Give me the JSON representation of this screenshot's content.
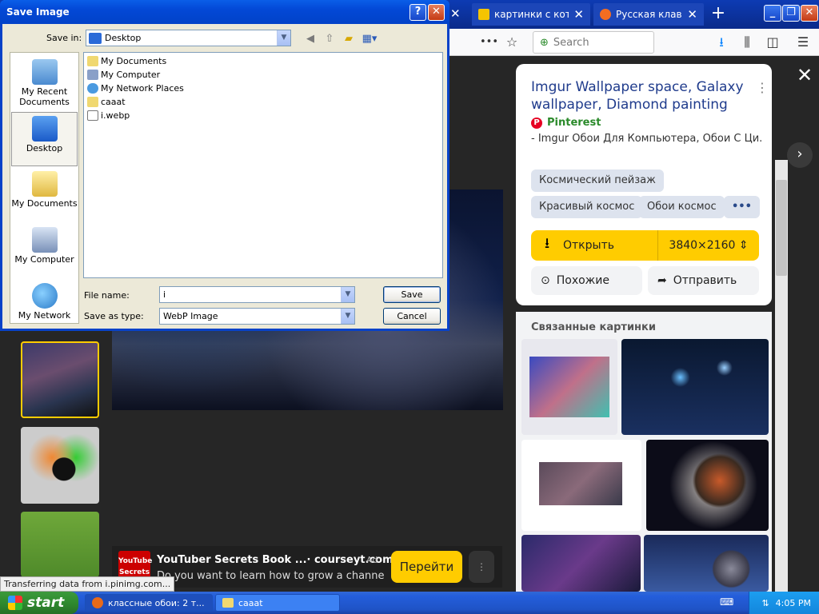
{
  "browser": {
    "tabs": [
      {
        "label": "картинки с коти",
        "close": "✕"
      },
      {
        "label": "Русская клавиат",
        "close": "✕"
      }
    ],
    "hidden_tab_close": "✕",
    "new_tab": "+",
    "window_buttons": {
      "minimize": "_",
      "maximize": "❐",
      "close": "✕"
    },
    "search": {
      "placeholder": "Search"
    },
    "overflow": "•••"
  },
  "viewer": {
    "close": "✕",
    "next": "›"
  },
  "panel": {
    "title": "Imgur Wallpaper space, Galaxy wallpaper, Diamond painting",
    "more": "⋮",
    "source": "Pinterest",
    "description": "- Imgur Обои Для Компьютера, Обои С Ци...",
    "tags": [
      "Космический пейзаж",
      "Красивый космос",
      "Обои космос",
      "•••"
    ],
    "open_label": "Открыть",
    "resolution": "3840×2160",
    "similar_label": "Похожие",
    "share_label": "Отправить",
    "related_title": "Связанные картинки"
  },
  "ad": {
    "title": "YouTuber Secrets Book ...· courseyt.com",
    "badge": "Ad",
    "description": "Do you want to learn how to grow a channel on...",
    "go_label": "Перейти",
    "more": "⋮",
    "logo_text": "YouTube Secrets"
  },
  "status_text": "Transferring data from i.pinimg.com...",
  "dialog": {
    "title": "Save Image",
    "help": "?",
    "close": "✕",
    "save_in_label": "Save in:",
    "save_in_value": "Desktop",
    "places": [
      "My Recent Documents",
      "Desktop",
      "My Documents",
      "My Computer",
      "My Network"
    ],
    "files": [
      "My Documents",
      "My Computer",
      "My Network Places",
      "caaat",
      "i.webp"
    ],
    "file_name_label": "File name:",
    "file_name_value": "i",
    "save_as_label": "Save as type:",
    "save_as_value": "WebP Image",
    "save_button": "Save",
    "cancel_button": "Cancel"
  },
  "taskbar": {
    "start_label": "start",
    "items": [
      "классные обои: 2 т...",
      "caaat"
    ],
    "clock": "4:05 PM"
  },
  "colors": {
    "accent_yellow": "#ffcc00",
    "xp_blue": "#0842c8",
    "link_blue": "#1f3b8c"
  }
}
